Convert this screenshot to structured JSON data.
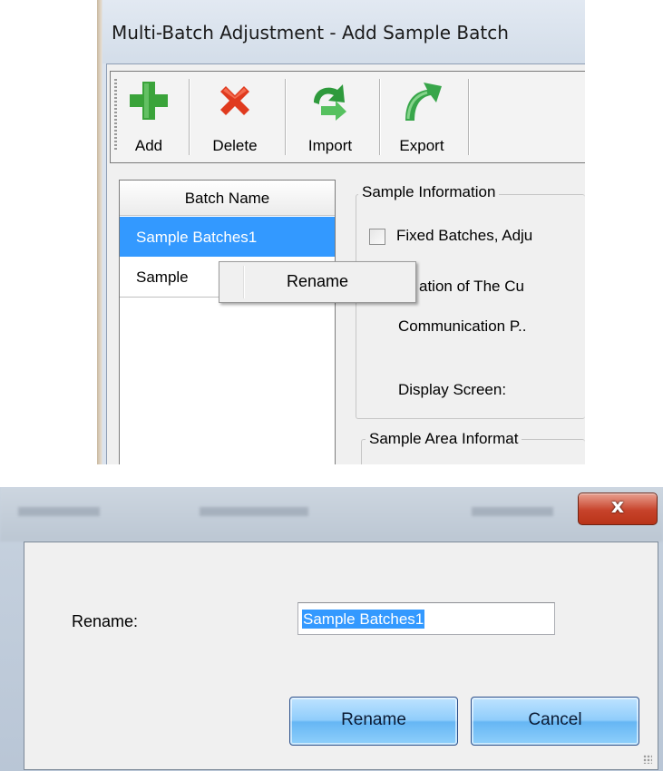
{
  "window": {
    "title": "Multi-Batch Adjustment - Add Sample Batch"
  },
  "toolbar": {
    "buttons": [
      {
        "label": "Add",
        "icon": "plus-icon",
        "color": "#3aa33a"
      },
      {
        "label": "Delete",
        "icon": "x-icon",
        "color": "#e03a1e"
      },
      {
        "label": "Import",
        "icon": "import-arrow-icon",
        "color": "#2e9a3c"
      },
      {
        "label": "Export",
        "icon": "export-arrow-icon",
        "color": "#38a64a"
      }
    ]
  },
  "batch_list": {
    "header": "Batch Name",
    "items": [
      "Sample Batches1",
      "Sample"
    ],
    "selected_index": 0
  },
  "context_menu": {
    "items": [
      "Rename"
    ]
  },
  "sample_info": {
    "group_title": "Sample Information",
    "checkbox_label": "Fixed Batches, Adju",
    "checkbox_checked": false,
    "location_label": "ation of The Cu",
    "comm_port_label": "Communication P..",
    "display_screen_label": "Display Screen:"
  },
  "sample_area": {
    "group_title": "Sample Area Informat"
  },
  "rename_dialog": {
    "close_symbol": "x",
    "label": "Rename:",
    "input_value": "Sample Batches1",
    "rename_button": "Rename",
    "cancel_button": "Cancel",
    "accent_color": "#3399ff"
  }
}
